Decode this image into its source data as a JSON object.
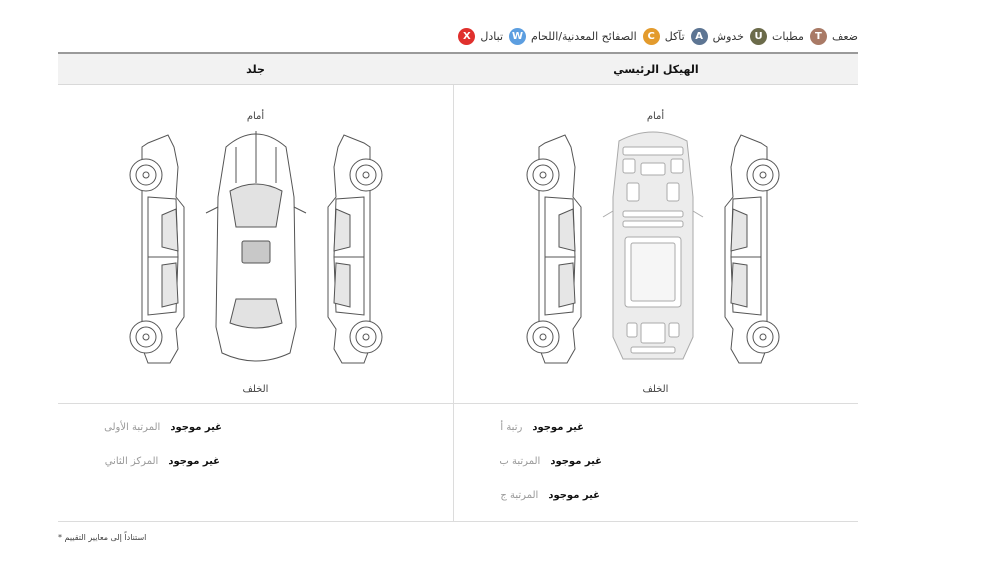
{
  "legend": [
    {
      "code": "T",
      "label": "ضعف",
      "color": "#a97a66"
    },
    {
      "code": "U",
      "label": "مطبات",
      "color": "#6b6b4a"
    },
    {
      "code": "A",
      "label": "خدوش",
      "color": "#5d7593"
    },
    {
      "code": "C",
      "label": "تآكل",
      "color": "#e39b2d"
    },
    {
      "code": "W",
      "label": "الصفائح المعدنية/اللحام",
      "color": "#5c9ee0"
    },
    {
      "code": "X",
      "label": "تبادل",
      "color": "#e0302d"
    }
  ],
  "headers": {
    "main": "الهيكل الرئيسي",
    "outer": "جلد"
  },
  "diagram": {
    "front": "أمام",
    "rear": "الخلف"
  },
  "main_grades": [
    {
      "status": "غير موجود",
      "name": "رتبة أ"
    },
    {
      "status": "غير موجود",
      "name": "المرتبة ب"
    },
    {
      "status": "غير موجود",
      "name": "المرتبة ج"
    }
  ],
  "outer_grades": [
    {
      "status": "غير موجود",
      "name": "المرتبة الأولى"
    },
    {
      "status": "غير موجود",
      "name": "المركز الثاني"
    }
  ],
  "footnote": "* استناداً إلى معايير التقييم"
}
